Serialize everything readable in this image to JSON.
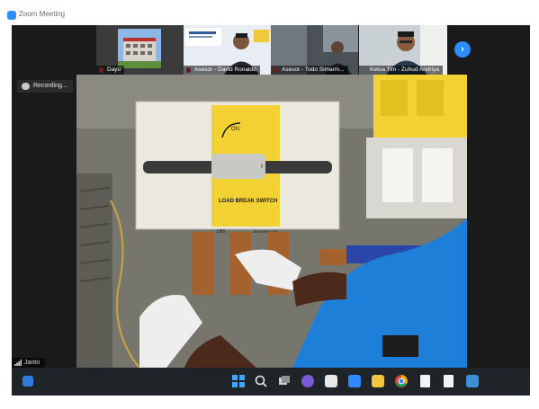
{
  "window": {
    "title": "Zoom Meeting"
  },
  "participants": [
    {
      "name": "Dayu",
      "muted": true
    },
    {
      "name": "Asesor - David Ronaldo",
      "muted": true
    },
    {
      "name": "Asesor - Todo Simarm...",
      "muted": true
    },
    {
      "name": "Ketua Tim - Zuhud Andriya",
      "muted": false
    }
  ],
  "recording": {
    "label": "Recording..."
  },
  "active_speaker": {
    "name": "Janto"
  },
  "switch_label": {
    "lines": [
      "LOAD BREAK SWITCH",
      "LBS",
      "JEAN MULLER"
    ],
    "on_text": "ON",
    "position_mark": "I"
  },
  "colors": {
    "zoom_blue": "#2d8cff",
    "switch_yellow": "#f2d232",
    "overall_blue": "#1e7fd9",
    "glove_white": "#eeeeee",
    "taskbar_bg": "#1f2428"
  },
  "taskbar": {
    "icons": [
      "windows-start-icon",
      "search-icon",
      "task-view-icon",
      "teams-chat-icon",
      "widgets-icon",
      "zoom-icon",
      "file-explorer-icon",
      "chrome-icon",
      "document-icon",
      "document-icon",
      "photos-icon"
    ]
  }
}
